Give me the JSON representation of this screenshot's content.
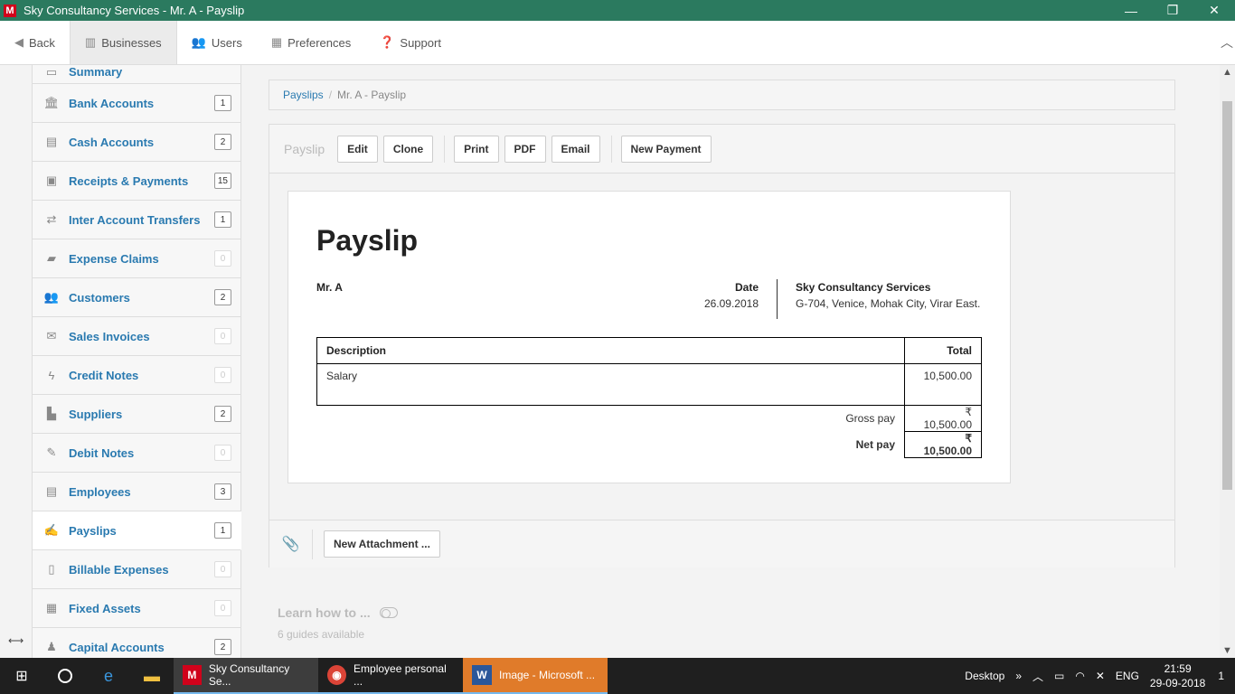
{
  "window": {
    "title": "Sky Consultancy Services - Mr. A - Payslip",
    "logo_letter": "M",
    "minimize": "—",
    "restore": "❐",
    "close": "✕"
  },
  "topnav": {
    "back": "Back",
    "businesses": "Businesses",
    "users": "Users",
    "preferences": "Preferences",
    "support": "Support"
  },
  "sidebar": {
    "items": [
      {
        "label": "Summary",
        "badge": ""
      },
      {
        "label": "Bank Accounts",
        "badge": "1"
      },
      {
        "label": "Cash Accounts",
        "badge": "2"
      },
      {
        "label": "Receipts & Payments",
        "badge": "15"
      },
      {
        "label": "Inter Account Transfers",
        "badge": "1"
      },
      {
        "label": "Expense Claims",
        "badge": "0"
      },
      {
        "label": "Customers",
        "badge": "2"
      },
      {
        "label": "Sales Invoices",
        "badge": "0"
      },
      {
        "label": "Credit Notes",
        "badge": "0"
      },
      {
        "label": "Suppliers",
        "badge": "2"
      },
      {
        "label": "Debit Notes",
        "badge": "0"
      },
      {
        "label": "Employees",
        "badge": "3"
      },
      {
        "label": "Payslips",
        "badge": "1"
      },
      {
        "label": "Billable Expenses",
        "badge": "0"
      },
      {
        "label": "Fixed Assets",
        "badge": "0"
      },
      {
        "label": "Capital Accounts",
        "badge": "2"
      }
    ]
  },
  "breadcrumb": {
    "link": "Payslips",
    "separator": "/",
    "current": "Mr. A - Payslip"
  },
  "toolbar": {
    "title": "Payslip",
    "edit": "Edit",
    "clone": "Clone",
    "print": "Print",
    "pdf": "PDF",
    "email": "Email",
    "new_payment": "New Payment"
  },
  "payslip": {
    "heading": "Payslip",
    "payee": "Mr. A",
    "date_label": "Date",
    "date_value": "26.09.2018",
    "company_name": "Sky Consultancy Services",
    "company_address": "G-704, Venice, Mohak City, Virar East.",
    "col_description": "Description",
    "col_total": "Total",
    "lines": [
      {
        "description": "Salary",
        "amount": "10,500.00"
      }
    ],
    "gross_label": "Gross pay",
    "gross_value": "₹ 10,500.00",
    "net_label": "Net pay",
    "net_value": "₹ 10,500.00"
  },
  "attachments": {
    "new_attachment": "New Attachment ..."
  },
  "learn": {
    "title": "Learn how to ...",
    "guides": "6 guides available"
  },
  "taskbar": {
    "tasks": [
      {
        "label": "Sky Consultancy Se..."
      },
      {
        "label": "Employee personal ..."
      },
      {
        "label": "Image - Microsoft ..."
      }
    ],
    "desktop": "Desktop",
    "lang": "ENG",
    "time": "21:59",
    "date": "29-09-2018",
    "notifications": "1"
  }
}
